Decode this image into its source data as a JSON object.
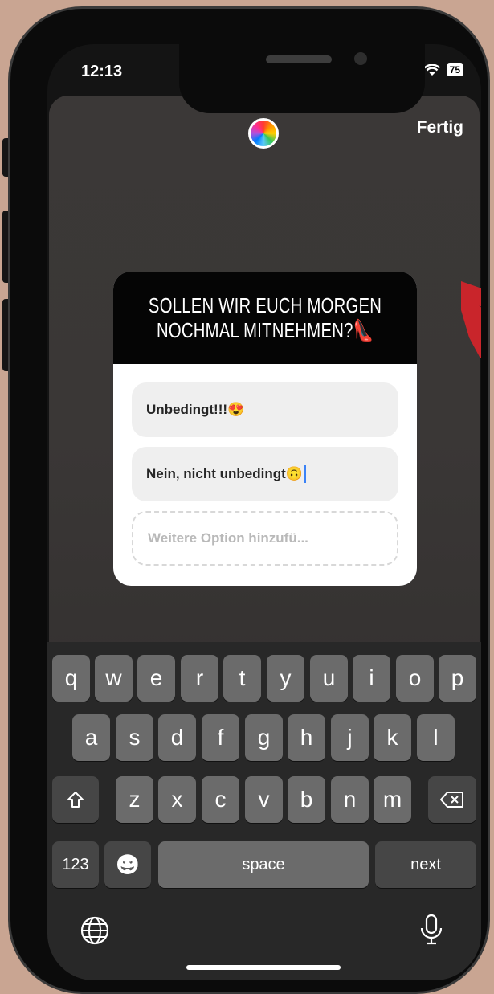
{
  "status": {
    "time": "12:13",
    "battery": "75"
  },
  "header": {
    "done_label": "Fertig",
    "color_picker_icon": "rainbow-color-wheel-icon"
  },
  "poll": {
    "question_line1": "SOLLEN WIR EUCH MORGEN",
    "question_line2": "NOCHMAL MITNEHMEN?👠",
    "options": [
      {
        "text": "Unbedingt!!!😍"
      },
      {
        "text": "Nein, nicht unbedingt🙃"
      }
    ],
    "add_option_placeholder": "Weitere Option hinzufü..."
  },
  "keyboard": {
    "row1": [
      "q",
      "w",
      "e",
      "r",
      "t",
      "y",
      "u",
      "i",
      "o",
      "p"
    ],
    "row2": [
      "a",
      "s",
      "d",
      "f",
      "g",
      "h",
      "j",
      "k",
      "l"
    ],
    "row3": [
      "z",
      "x",
      "c",
      "v",
      "b",
      "n",
      "m"
    ],
    "numbers_label": "123",
    "space_label": "space",
    "next_label": "next",
    "emoji_icon": "😀"
  },
  "colors": {
    "arrow": "#c9252b",
    "keyboard_bg": "#282828",
    "key": "#6b6b6b"
  }
}
